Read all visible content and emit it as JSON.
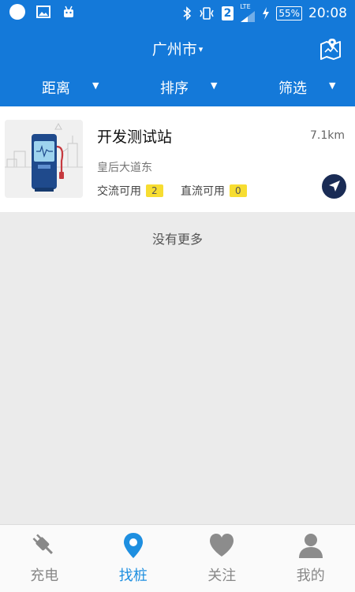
{
  "status_bar": {
    "signal_badge": "2",
    "network": "LTE",
    "battery": "55%",
    "time": "20:08"
  },
  "header": {
    "city": "广州市",
    "caret": "▾"
  },
  "filters": [
    {
      "label": "距离",
      "arrow": "▼"
    },
    {
      "label": "排序",
      "arrow": "▼"
    },
    {
      "label": "筛选",
      "arrow": "▼"
    }
  ],
  "station": {
    "name": "开发测试站",
    "distance": "7.1km",
    "address": "皇后大道东",
    "ac_label": "交流可用",
    "ac_count": "2",
    "dc_label": "直流可用",
    "dc_count": "0"
  },
  "list": {
    "end_text": "没有更多"
  },
  "tabs": [
    {
      "label": "充电",
      "icon": "plug-icon",
      "active": false
    },
    {
      "label": "找桩",
      "icon": "location-pin-icon",
      "active": true
    },
    {
      "label": "关注",
      "icon": "heart-icon",
      "active": false
    },
    {
      "label": "我的",
      "icon": "user-icon",
      "active": false
    }
  ],
  "colors": {
    "primary": "#1479d9",
    "badge": "#f7dd31",
    "active_tab": "#1e8fe0",
    "nav_button": "#1a2c55"
  }
}
